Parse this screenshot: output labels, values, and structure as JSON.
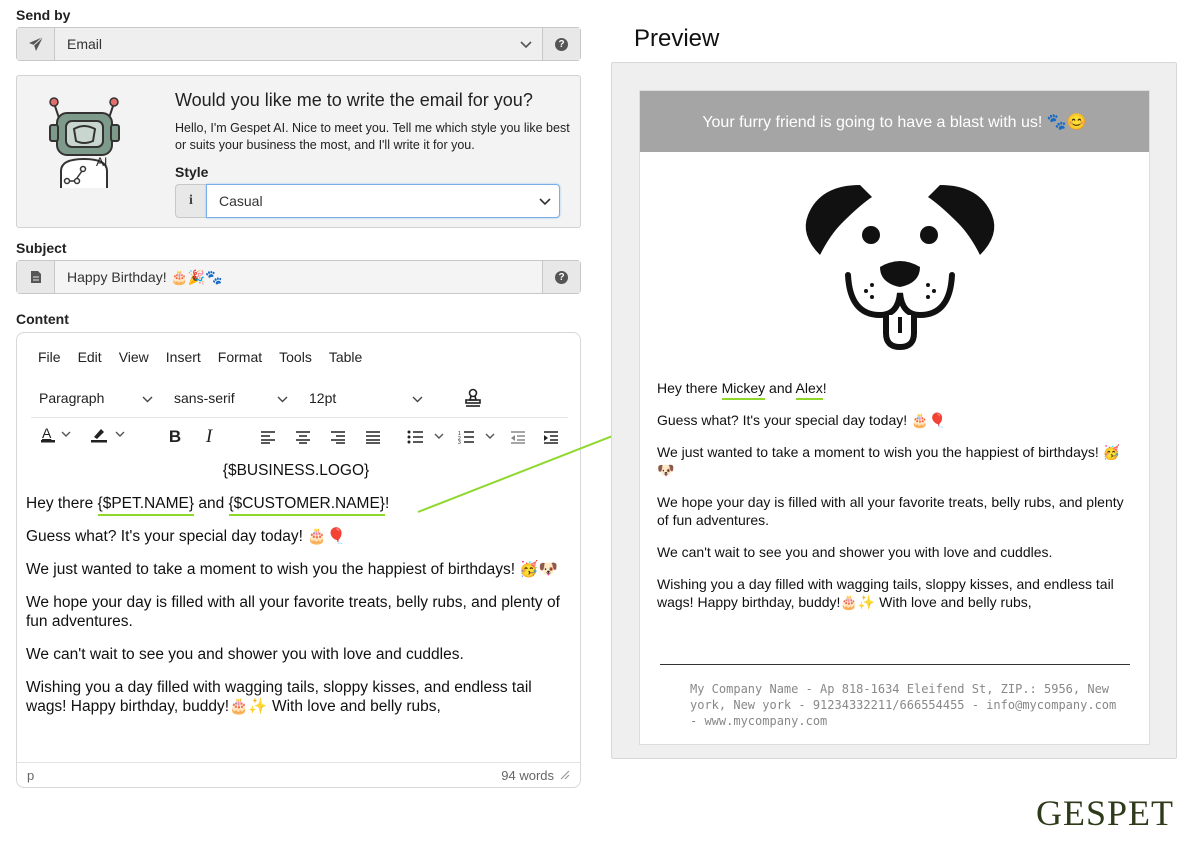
{
  "send_by": {
    "label": "Send by",
    "value": "Email"
  },
  "ai": {
    "title": "Would you like me to write the email for you?",
    "text": "Hello, I'm Gespet AI. Nice to meet you. Tell me which style you like best or suits your business the most, and I'll write it for you.",
    "style_label": "Style",
    "style_value": "Casual",
    "robot_badge": "AI"
  },
  "subject": {
    "label": "Subject",
    "value": "Happy Birthday! 🎂🎉🐾"
  },
  "content": {
    "label": "Content",
    "menu": [
      "File",
      "Edit",
      "View",
      "Insert",
      "Format",
      "Tools",
      "Table"
    ],
    "block_format": "Paragraph",
    "font_family": "sans-serif",
    "font_size": "12pt",
    "logo_placeholder": "{$BUSINESS.LOGO}",
    "greet_prefix": "Hey there ",
    "pet_var": "{$PET.NAME}",
    "greet_mid": " and ",
    "customer_var": "{$CUSTOMER.NAME}",
    "greet_suffix": "!",
    "p2": "Guess what? It's your special day today! 🎂🎈",
    "p3": "We just wanted to take a moment to wish you the happiest of birthdays! 🥳🐶",
    "p4": "We hope your day is filled with all your favorite treats, belly rubs, and plenty of fun adventures.",
    "p5": "We can't wait to see you and shower you with love and cuddles.",
    "p6": "Wishing you a day filled with wagging tails, sloppy kisses, and endless tail wags! Happy birthday, buddy!🎂✨ With love and belly rubs,",
    "status_element": "p",
    "word_count": "94 words"
  },
  "preview": {
    "title": "Preview",
    "header": "Your furry friend is going to have a blast with us! 🐾😊",
    "greet_prefix": "Hey there ",
    "pet_name": "Mickey",
    "greet_mid": " and ",
    "customer_name": "Alex",
    "greet_suffix": "!",
    "p2": "Guess what? It's your special day today! 🎂🎈",
    "p3": "We just wanted to take a moment to wish you the happiest of birthdays! 🥳🐶",
    "p4": "We hope your day is filled with all your favorite treats, belly rubs, and plenty of fun adventures.",
    "p5": "We can't wait to see you and shower you with love and cuddles.",
    "p6": "Wishing you a day filled with wagging tails, sloppy kisses, and endless tail wags! Happy birthday, buddy!🎂✨ With love and belly rubs,",
    "footer": "My Company Name - Ap 818-1634 Eleifend St, ZIP.: 5956, New york, New york - 91234332211/666554455 - info@mycompany.com - www.mycompany.com"
  },
  "brand": "GESPET",
  "colors": {
    "highlight_green": "#8ed82c",
    "preview_header": "#a5a5a5",
    "brand": "#2e3b1a",
    "select_focus": "#7aaee6"
  }
}
